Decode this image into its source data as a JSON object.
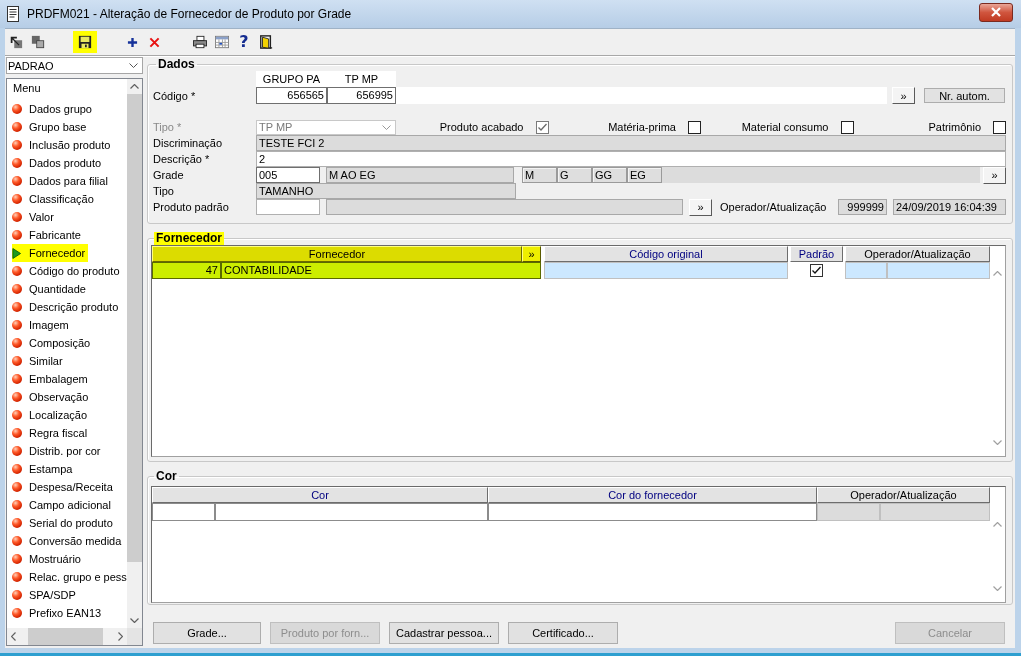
{
  "window": {
    "title": "PRDFM021 - Alteração de Fornecedor de Produto por Grade"
  },
  "toolbar": [
    [
      {
        "kind": "pointer",
        "highlighted": false
      },
      {
        "kind": "windows",
        "highlighted": false
      }
    ],
    [
      {
        "kind": "save",
        "highlighted": true
      }
    ],
    [
      {
        "kind": "add",
        "highlighted": false
      },
      {
        "kind": "delete",
        "highlighted": false
      }
    ],
    [
      {
        "kind": "print",
        "highlighted": false
      },
      {
        "kind": "calendar",
        "highlighted": false
      },
      {
        "kind": "help",
        "glyph": "?",
        "highlighted": false
      },
      {
        "kind": "exit",
        "highlighted": false
      }
    ]
  ],
  "profile_select": {
    "value": "PADRAO"
  },
  "menu": {
    "title": "Menu",
    "items": [
      {
        "label": "Dados grupo",
        "selected": false
      },
      {
        "label": "Grupo base",
        "selected": false
      },
      {
        "label": "Inclusão produto",
        "selected": false
      },
      {
        "label": "Dados produto",
        "selected": false
      },
      {
        "label": "Dados para filial",
        "selected": false
      },
      {
        "label": "Classificação",
        "selected": false
      },
      {
        "label": "Valor",
        "selected": false
      },
      {
        "label": "Fabricante",
        "selected": false
      },
      {
        "label": "Fornecedor",
        "selected": true
      },
      {
        "label": "Código do produto",
        "selected": false
      },
      {
        "label": "Quantidade",
        "selected": false
      },
      {
        "label": "Descrição produto",
        "selected": false
      },
      {
        "label": "Imagem",
        "selected": false
      },
      {
        "label": "Composição",
        "selected": false
      },
      {
        "label": "Similar",
        "selected": false
      },
      {
        "label": "Embalagem",
        "selected": false
      },
      {
        "label": "Observação",
        "selected": false
      },
      {
        "label": "Localização",
        "selected": false
      },
      {
        "label": "Regra fiscal",
        "selected": false
      },
      {
        "label": "Distrib. por cor",
        "selected": false
      },
      {
        "label": "Estampa",
        "selected": false
      },
      {
        "label": "Despesa/Receita",
        "selected": false
      },
      {
        "label": "Campo adicional",
        "selected": false
      },
      {
        "label": "Serial do produto",
        "selected": false
      },
      {
        "label": "Conversão medida",
        "selected": false
      },
      {
        "label": "Mostruário",
        "selected": false
      },
      {
        "label": "Relac. grupo e pess",
        "selected": false
      },
      {
        "label": "SPA/SDP",
        "selected": false
      },
      {
        "label": "Prefixo EAN13",
        "selected": false
      }
    ]
  },
  "dados": {
    "title": "Dados",
    "codigo": {
      "label": "Código *",
      "parts": [
        {
          "header": "GRUPO PA",
          "value": "656565"
        },
        {
          "header": "TP MP",
          "value": "656995"
        }
      ],
      "lookup_button": "»",
      "auto_button": "Nr. autom."
    },
    "tipo": {
      "label": "Tipo *",
      "value": "TP MP",
      "disabled": true
    },
    "flags": [
      {
        "label": "Produto acabado",
        "checked": true,
        "disabled": true
      },
      {
        "label": "Matéria-prima",
        "checked": false,
        "disabled": false
      },
      {
        "label": "Material consumo",
        "checked": false,
        "disabled": false
      },
      {
        "label": "Patrimônio",
        "checked": false,
        "disabled": false
      }
    ],
    "discriminacao": {
      "label": "Discriminação",
      "value": "TESTE FCI 2",
      "readonly": true
    },
    "descricao": {
      "label": "Descrição *",
      "value": "2",
      "readonly": false
    },
    "grade": {
      "label": "Grade",
      "code": "005",
      "description": "M AO EG",
      "sizes": [
        "M",
        "G",
        "GG",
        "EG"
      ],
      "lookup_button": "»"
    },
    "tipo_grade": {
      "label": "Tipo",
      "value": "TAMANHO"
    },
    "produto_padrao": {
      "label": "Produto padrão",
      "lookup_button": "»",
      "operator_label": "Operador/Atualização",
      "operator": "999999",
      "updated": "24/09/2019 16:04:39"
    }
  },
  "fornecedor": {
    "title": "Fornecedor",
    "highlighted": true,
    "lookup_button": "»",
    "columns": [
      {
        "label": "Fornecedor",
        "color": "#000000"
      },
      {
        "label": "Código original",
        "color": "#000080"
      },
      {
        "label": "Padrão",
        "color": "#000080"
      },
      {
        "label": "Operador/Atualização",
        "color": "#000000"
      }
    ],
    "rows": [
      {
        "code": "47",
        "name": "CONTABILIDADE",
        "padrao": true,
        "selected": true
      }
    ]
  },
  "cor": {
    "title": "Cor",
    "columns": [
      {
        "label": "Cor",
        "color": "#000080"
      },
      {
        "label": "Cor do fornecedor",
        "color": "#000080"
      },
      {
        "label": "Operador/Atualização",
        "color": "#000000"
      }
    ],
    "rows": [
      {
        "selected": false
      }
    ]
  },
  "buttons": {
    "left": [
      {
        "label": "Grade...",
        "disabled": false
      },
      {
        "label": "Produto por forn...",
        "disabled": true
      },
      {
        "label": "Cadastrar pessoa...",
        "disabled": false
      },
      {
        "label": "Certificado...",
        "disabled": false
      }
    ],
    "right": [
      {
        "label": "Cancelar",
        "disabled": true
      }
    ]
  }
}
